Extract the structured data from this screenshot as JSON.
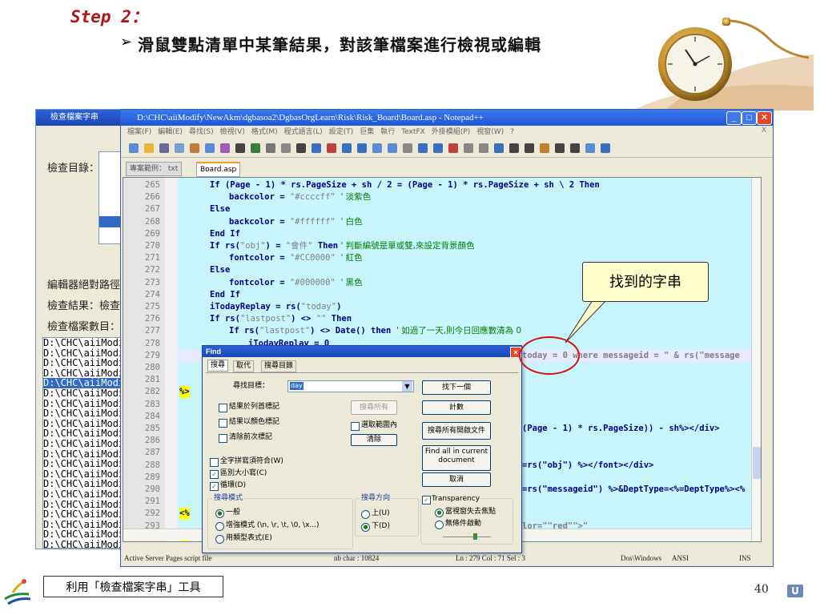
{
  "slide": {
    "step_title": "Step 2：",
    "bullet": "➢",
    "subtitle": "滑鼠雙點清單中某筆結果，對該筆檔案進行檢視或編輯",
    "footer_label": "利用「檢查檔案字串」工具",
    "page_number": "40",
    "corner_logo": "U"
  },
  "callout": {
    "text": "找到的字串"
  },
  "check_tool": {
    "title": "檢查檔案字串",
    "label_dir": "檢查目錄：",
    "label_editor": "編輯器絕對路徑",
    "label_result": "檢查結果：檢查",
    "label_count": "檢查檔案數目：",
    "paths": [
      "D:\\CHC\\aiiModi",
      "D:\\CHC\\aiiModi",
      "D:\\CHC\\aiiModi",
      "D:\\CHC\\aiiModi",
      "D:\\CHC\\aiiModi",
      "D:\\CHC\\aiiModi",
      "D:\\CHC\\aiiModi",
      "D:\\CHC\\aiiModi",
      "D:\\CHC\\aiiModi",
      "D:\\CHC\\aiiModi",
      "D:\\CHC\\aiiModi",
      "D:\\CHC\\aiiModi",
      "D:\\CHC\\aiiModi",
      "D:\\CHC\\aiiModi",
      "D:\\CHC\\aiiModi",
      "D:\\CHC\\aiiModi",
      "D:\\CHC\\aiiModi",
      "D:\\CHC\\aiiModi",
      "D:\\CHC\\aiiModi",
      "D:\\CHC\\aiiModi",
      "D:\\CHC\\aiiModi"
    ],
    "selected_index": 4
  },
  "notepad": {
    "title": "D:\\CHC\\aiiModify\\NewAkm\\dgbasoa2\\DgbasOrgLearn\\Risk\\Risk_Board\\Board.asp - Notepad++",
    "menu": [
      "檔案(F)",
      "編輯(E)",
      "尋找(S)",
      "檢視(V)",
      "格式(M)",
      "程式語言(L)",
      "設定(T)",
      "巨集",
      "執行",
      "TextFX",
      "外掛模組(P)",
      "視窗(W)",
      "?"
    ],
    "menu_close": "X",
    "tabs": [
      "專案範例： txt",
      "Board.asp"
    ],
    "status": {
      "lang": "Active Server Pages script file",
      "chars": "nb char : 10824",
      "pos": "Ln : 279    Col : 71    Sel : 3",
      "eol": "Dos\\Windows",
      "enc": "ANSI",
      "mode": "INS"
    },
    "lines": [
      {
        "n": "265",
        "c": [
          [
            "kw",
            "If "
          ],
          [
            "",
            "(Page - 1) * rs.PageSize + sh / 2 = (Page - 1) * rs.PageSize + sh \\ 2 "
          ],
          [
            "kw",
            "Then"
          ]
        ],
        "indent": 0
      },
      {
        "n": "266",
        "c": [
          [
            "",
            "backcolor = "
          ],
          [
            "str",
            "\"#ccccff\""
          ],
          [
            "cm",
            "  ' 淡紫色"
          ]
        ],
        "indent": 2
      },
      {
        "n": "267",
        "c": [
          [
            "kw",
            "Else"
          ]
        ],
        "indent": 0
      },
      {
        "n": "268",
        "c": [
          [
            "",
            "backcolor = "
          ],
          [
            "str",
            "\"#ffffff\""
          ],
          [
            "cm",
            "  ' 白色"
          ]
        ],
        "indent": 2
      },
      {
        "n": "269",
        "c": [
          [
            "kw",
            "End If"
          ]
        ],
        "indent": 0
      },
      {
        "n": "270",
        "c": [
          [
            "kw",
            "If "
          ],
          [
            "",
            "rs("
          ],
          [
            "str",
            "\"obj\""
          ],
          [
            "",
            ") = "
          ],
          [
            "str",
            "\"會件\""
          ],
          [
            "kw",
            " Then"
          ],
          [
            "cm",
            " ' 判斷編號是單或雙,來設定背景顏色"
          ]
        ],
        "indent": 0
      },
      {
        "n": "271",
        "c": [
          [
            "",
            "fontcolor = "
          ],
          [
            "str",
            "\"#CC0000\""
          ],
          [
            "cm",
            "  ' 紅色"
          ]
        ],
        "indent": 2
      },
      {
        "n": "272",
        "c": [
          [
            "kw",
            "Else"
          ]
        ],
        "indent": 0
      },
      {
        "n": "273",
        "c": [
          [
            "",
            "fontcolor = "
          ],
          [
            "str",
            "\"#000000\""
          ],
          [
            "cm",
            "  ' 黑色"
          ]
        ],
        "indent": 2
      },
      {
        "n": "274",
        "c": [
          [
            "kw",
            "End If"
          ]
        ],
        "indent": 0
      },
      {
        "n": "275",
        "c": [
          [
            "",
            "iTodayReplay = rs("
          ],
          [
            "str",
            "\"today\""
          ],
          [
            "",
            ")"
          ]
        ],
        "indent": 0
      },
      {
        "n": "276",
        "c": [
          [
            "kw",
            "If "
          ],
          [
            "",
            "rs("
          ],
          [
            "str",
            "\"lastpost\""
          ],
          [
            "",
            ") <> "
          ],
          [
            "str",
            "\"\""
          ],
          [
            "kw",
            " Then"
          ]
        ],
        "indent": 0
      },
      {
        "n": "277",
        "c": [
          [
            "kw",
            "If "
          ],
          [
            "",
            "rs("
          ],
          [
            "str",
            "\"lastpost\""
          ],
          [
            "",
            ") <> "
          ],
          [
            "kw",
            "Date"
          ],
          [
            "",
            "() "
          ],
          [
            "kw",
            "then"
          ],
          [
            "cm",
            "  ' 如過了一天,則今日回應數清為 0"
          ]
        ],
        "indent": 2
      },
      {
        "n": "278",
        "c": [
          [
            "",
            "iTodayReplay = 0"
          ]
        ],
        "indent": 4
      },
      {
        "n": "279",
        "c": [],
        "indent": 0
      },
      {
        "n": "280",
        "c": [],
        "indent": 0
      },
      {
        "n": "281",
        "c": [],
        "indent": 0
      },
      {
        "n": "282",
        "c": [],
        "indent": 0
      },
      {
        "n": "283",
        "c": [],
        "indent": 0
      },
      {
        "n": "284",
        "c": [],
        "indent": 0
      },
      {
        "n": "285",
        "c": [],
        "indent": 0
      },
      {
        "n": "286",
        "c": [],
        "indent": 0
      },
      {
        "n": "287",
        "c": [],
        "indent": 0
      },
      {
        "n": "288",
        "c": [],
        "indent": 0
      },
      {
        "n": "289",
        "c": [],
        "indent": 0
      },
      {
        "n": "290",
        "c": [],
        "indent": 0
      },
      {
        "n": "291",
        "c": [],
        "indent": 0
      },
      {
        "n": "292",
        "c": [],
        "indent": 0
      },
      {
        "n": "293",
        "c": [],
        "indent": 0
      },
      {
        "n": "294",
        "c": [],
        "indent": 0
      }
    ],
    "right_fragments": {
      "l279": "today = 0 where messageid = \" & rs(\"message",
      "l285": "(Page - 1) * rs.PageSize)) - sh%></div>",
      "l288": "=rs(\"obj\") %></font></div>",
      "l290": "=rs(\"messageid\") %>&DeptType=<%=DeptType%><%",
      "l293": "lor=\"\"red\"\">\"",
      "l282_tag": "%>",
      "l292_tag": "<%",
      "l294_tag": "%>"
    }
  },
  "find": {
    "title": "Find",
    "tabs": [
      "搜尋",
      "取代",
      "搜尋目錄"
    ],
    "target_label": "尋找目標：",
    "target_value": "day",
    "opt_bookmark": "結果於列首標記",
    "opt_color": "結果以顏色標記",
    "opt_clear": "清除前次標記",
    "btn_search_all": "搜尋所有",
    "opt_in_selection": "選取範圍內",
    "btn_clear": "清除",
    "opt_whole_word": "全字拼寫須符合(W)",
    "opt_match_case": "區別大小寫(C)",
    "opt_wrap": "循環(D)",
    "mode_title": "搜尋模式",
    "mode_normal": "一般",
    "mode_extended": "增強模式 (\\n, \\r, \\t, \\0, \\x...)",
    "mode_regex": "用類型表式(E)",
    "dir_title": "搜尋方向",
    "dir_up": "上(U)",
    "dir_down": "下(D)",
    "transparency": "Transparency",
    "trans_lose_focus": "當視窗失去焦點",
    "trans_always": "無條件啟動",
    "btn_find_next": "找下一個",
    "btn_count": "計數",
    "btn_find_all_open": "搜尋所有開啟文件",
    "btn_find_all_current_1": "Find all in current",
    "btn_find_all_current_2": "document",
    "btn_cancel": "取消",
    "close_glyph": "×"
  }
}
